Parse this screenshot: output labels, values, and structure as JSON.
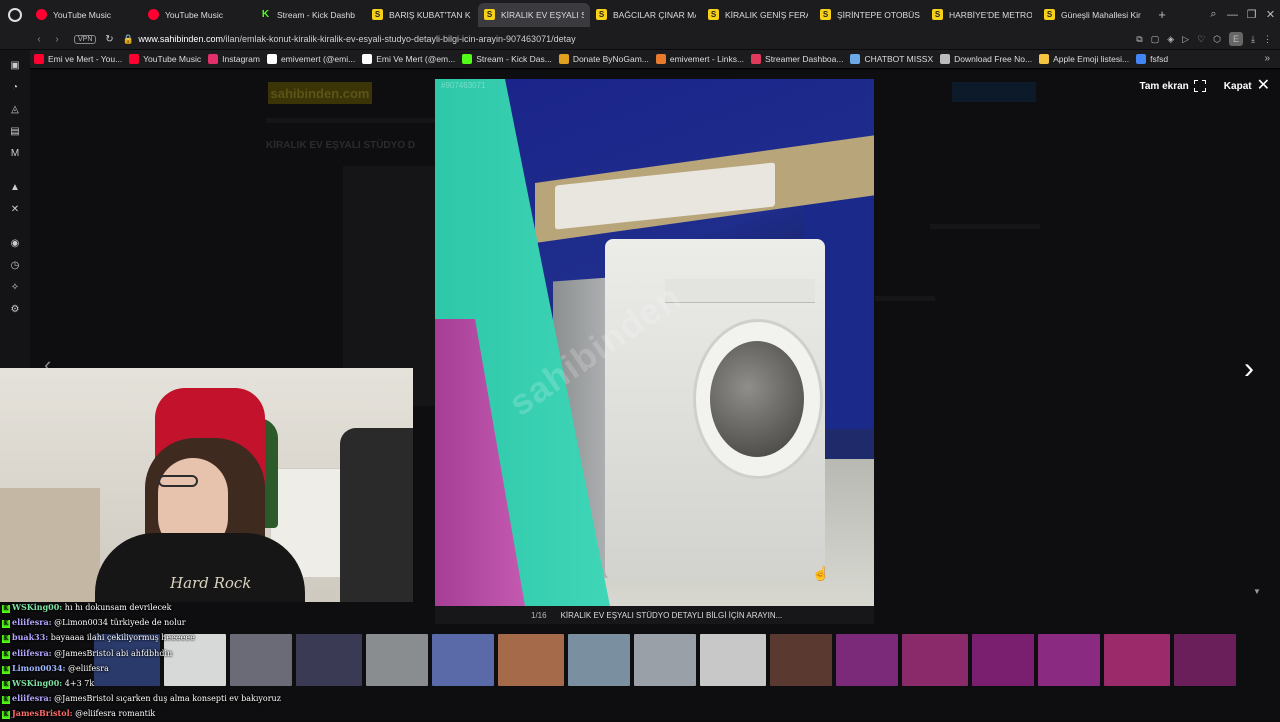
{
  "browser": {
    "tabs": [
      {
        "label": "YouTube Music",
        "icon": "youtube-music-icon",
        "kind": "yt"
      },
      {
        "label": "YouTube Music",
        "icon": "youtube-music-icon",
        "kind": "yt"
      },
      {
        "label": "Stream - Kick Dashb",
        "icon": "kick-icon",
        "kind": "kick"
      },
      {
        "label": "BARIŞ KUBAT'TAN K",
        "icon": "sahibinden-icon",
        "kind": "s"
      },
      {
        "label": "KİRALIK EV EŞYALI STÜD",
        "icon": "sahibinden-icon",
        "kind": "s",
        "active": true
      },
      {
        "label": "BAĞCILAR ÇINAR MA",
        "icon": "sahibinden-icon",
        "kind": "s"
      },
      {
        "label": "KİRALIK GENİŞ FERA",
        "icon": "sahibinden-icon",
        "kind": "s"
      },
      {
        "label": "ŞİRİNTEPE OTOBÜS",
        "icon": "sahibinden-icon",
        "kind": "s"
      },
      {
        "label": "HARBİYE'DE METRO",
        "icon": "sahibinden-icon",
        "kind": "s"
      },
      {
        "label": "Güneşli Mahallesi Kir",
        "icon": "sahibinden-icon",
        "kind": "s"
      }
    ],
    "new_tab": "+",
    "vpn_label": "VPN",
    "url_host": "www.sahibinden.com",
    "url_path": "/ilan/emlak-konut-kiralik-kiralik-ev-esyali-studyo-detayli-bilgi-icin-arayin-907463071/detay",
    "profile_letter": "E"
  },
  "bookmarks": [
    {
      "label": "Emi ve Mert - You...",
      "icon": "youtube-icon",
      "color": "#ff0033"
    },
    {
      "label": "YouTube Music",
      "icon": "youtube-music-icon",
      "color": "#ff0033"
    },
    {
      "label": "Instagram",
      "icon": "instagram-icon",
      "color": "#e1306c"
    },
    {
      "label": "emivemert (@emi...",
      "icon": "tiktok-icon",
      "color": "#ffffff"
    },
    {
      "label": "Emi Ve Mert (@em...",
      "icon": "x-icon",
      "color": "#ffffff"
    },
    {
      "label": "Stream - Kick Das...",
      "icon": "kick-icon",
      "color": "#53fc18"
    },
    {
      "label": "Donate ByNoGam...",
      "icon": "donate-icon",
      "color": "#e0a020"
    },
    {
      "label": "emivemert - Links...",
      "icon": "linktree-icon",
      "color": "#e87a2e"
    },
    {
      "label": "Streamer Dashboa...",
      "icon": "streamer-icon",
      "color": "#e03a5a"
    },
    {
      "label": "CHATBOT MISSX",
      "icon": "chatbot-icon",
      "color": "#6aa8e8"
    },
    {
      "label": "Download Free No...",
      "icon": "download-icon",
      "color": "#bbbbbb"
    },
    {
      "label": "Apple Emoji listesi...",
      "icon": "emoji-icon",
      "color": "#f5c542"
    },
    {
      "label": "fsfsd",
      "icon": "google-icon",
      "color": "#4285f4"
    }
  ],
  "site": {
    "logo": "sahibinden.com",
    "title": "KİRALIK EV EŞYALI STÜDYO D",
    "listing_id": "#907463071"
  },
  "lightbox": {
    "fullscreen_label": "Tam ekran",
    "close_label": "Kapat",
    "counter": "1/16",
    "caption": "KİRALIK EV EŞYALI STÜDYO DETAYLI BİLGİ İÇİN ARAYIN...",
    "watermark": "sahibinden",
    "thumb_colors": [
      "#2a3a6a",
      "#d7d9d9",
      "#6b6b78",
      "#3a3a55",
      "#8a8d8f",
      "#5a6aa8",
      "#a56a4a",
      "#7a8fa0",
      "#9aa0a8",
      "#c8c8c8",
      "#5a3a30",
      "#7a2a78",
      "#8a2a6a",
      "#7a1f70",
      "#8a2a80",
      "#9a2a6a",
      "#6a1e5a"
    ]
  },
  "chat": [
    {
      "user": "WSKing00:",
      "user_color": "#7fe3a3",
      "text": "hı hı dokunsam devrilecek"
    },
    {
      "user": "eliifesra:",
      "user_color": "#b4a7ff",
      "text": "@Limon0034 türkiyede de nolur"
    },
    {
      "user": "buak33:",
      "user_color": "#b4a7ff",
      "text": "bayaaaa ilahi çekiliyormuş heeeeee"
    },
    {
      "user": "eliifesra:",
      "user_color": "#b4a7ff",
      "text": "@JamesBristol abi ahfdbhdin"
    },
    {
      "user": "Limon0034:",
      "user_color": "#9fb7ff",
      "text": "@eliifesra"
    },
    {
      "user": "WSKing00:",
      "user_color": "#7fe3a3",
      "text": "4+3 7k"
    },
    {
      "user": "eliifesra:",
      "user_color": "#b4a7ff",
      "text": "@JamesBristol sıçarken duş alma konsepti ev bakıyoruz"
    },
    {
      "user": "JamesBristol:",
      "user_color": "#ff6b6b",
      "text": "@eliifesra romantik"
    }
  ],
  "webcam": {
    "shirt_text": "Hard Rock"
  }
}
